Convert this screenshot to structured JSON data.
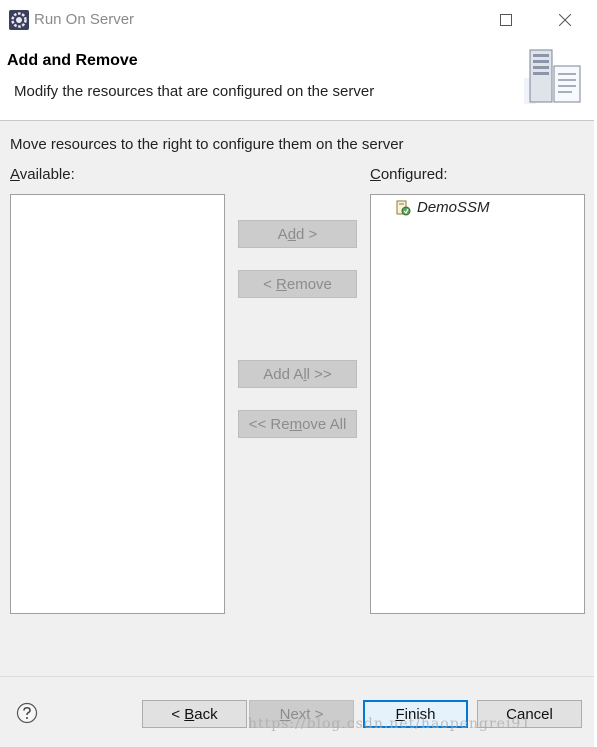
{
  "window": {
    "title": "Run On Server",
    "controls": {
      "minimize": "minimize-icon",
      "maximize": "maximize-icon",
      "close": "close-icon"
    }
  },
  "banner": {
    "title": "Add and Remove",
    "description": "Modify the resources that are configured on the server",
    "image": "server-wizard-icon"
  },
  "content": {
    "instruction": "Move resources to the right to configure them on the server",
    "available_label": {
      "mnemonic": "A",
      "rest": "vailable:"
    },
    "configured_label": {
      "mnemonic": "C",
      "rest": "onfigured:"
    },
    "available_items": [],
    "configured_items": [
      {
        "label": "DemoSSM",
        "icon": "web-project-icon"
      }
    ]
  },
  "move_buttons": {
    "add": {
      "pre": "A",
      "mnemonic": "d",
      "post": "d >",
      "enabled": false
    },
    "remove": {
      "pre": "< ",
      "mnemonic": "R",
      "post": "emove",
      "enabled": false
    },
    "add_all": {
      "pre": "Add A",
      "mnemonic": "l",
      "post": "l >>",
      "enabled": false
    },
    "remove_all": {
      "pre": "<< Re",
      "mnemonic": "m",
      "post": "ove All",
      "enabled": false
    }
  },
  "footer": {
    "help_icon": "help-icon",
    "back": {
      "pre": "< ",
      "mnemonic": "B",
      "post": "ack",
      "enabled": true
    },
    "next": {
      "pre": "",
      "mnemonic": "N",
      "post": "ext >",
      "enabled": false
    },
    "finish": {
      "pre": "",
      "mnemonic": "F",
      "post": "inish",
      "enabled": true
    },
    "cancel": {
      "label": "Cancel",
      "enabled": true
    }
  },
  "watermark": "https://blog.csdn.net/haopengrei91",
  "colors": {
    "dialog_bg": "#f0f0f0",
    "disabled_button_bg": "#cccccc",
    "disabled_text": "#8c8c8c",
    "focus_border": "#0078d7"
  }
}
